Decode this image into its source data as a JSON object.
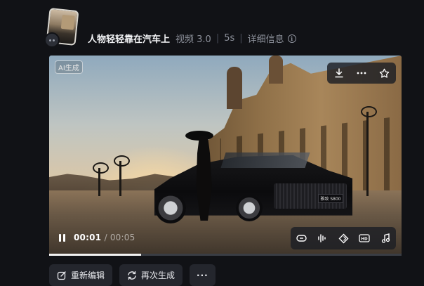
{
  "header": {
    "title": "人物轻轻靠在汽车上",
    "model": "视频 3.0",
    "duration": "5s",
    "details_label": "详细信息",
    "info_icon": "i"
  },
  "video": {
    "ai_tag": "AI生成",
    "plate_text": "雅致 S800",
    "current_time": "00:01",
    "total_time": "/ 00:05",
    "progress": 0.26,
    "top_tools": [
      "download-icon",
      "more-icon",
      "star-icon"
    ],
    "bottom_tools": [
      "loop-icon",
      "audio-wave-icon",
      "diamond-icon",
      "hd-icon",
      "music-icon"
    ],
    "hd_label": "HD"
  },
  "actions": {
    "edit_label": "重新编辑",
    "regenerate_label": "再次生成",
    "more_label": "···"
  }
}
